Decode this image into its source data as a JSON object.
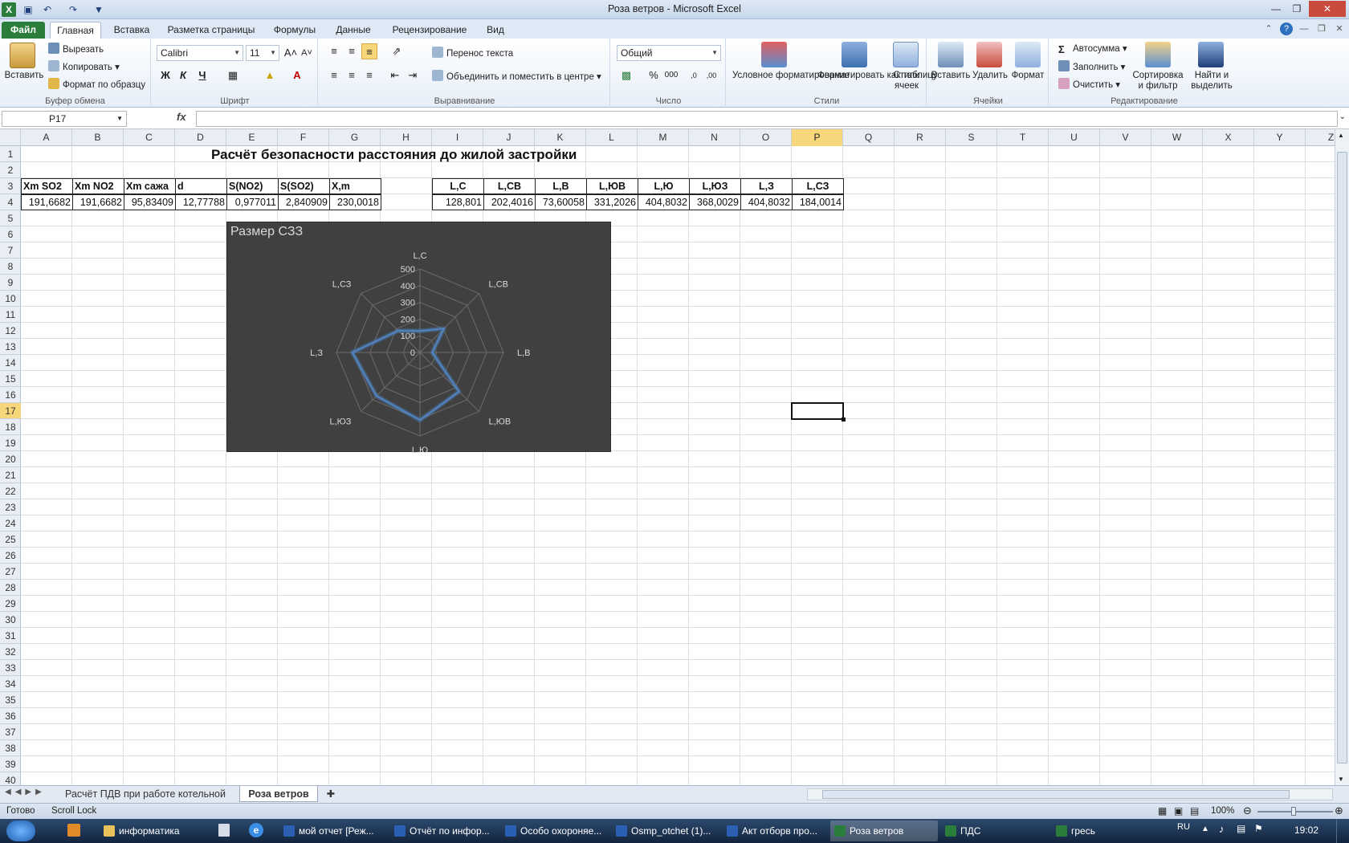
{
  "window": {
    "title": "Роза ветров  -  Microsoft Excel"
  },
  "tabs": [
    "Файл",
    "Главная",
    "Вставка",
    "Разметка страницы",
    "Формулы",
    "Данные",
    "Рецензирование",
    "Вид"
  ],
  "ribbon": {
    "clipboard": {
      "paste": "Вставить",
      "cut": "Вырезать",
      "copy": "Копировать",
      "format_painter": "Формат по образцу",
      "label": "Буфер обмена"
    },
    "font": {
      "name": "Calibri",
      "size": "11",
      "bold": "Ж",
      "italic": "К",
      "underline": "Ч",
      "label": "Шрифт"
    },
    "alignment": {
      "wrap": "Перенос текста",
      "merge": "Объединить и поместить в центре",
      "label": "Выравнивание"
    },
    "number": {
      "format": "Общий",
      "label": "Число"
    },
    "styles": {
      "conditional": "Условное форматирование",
      "as_table": "Форматировать как таблицу",
      "cell_styles": "Стили ячеек",
      "label": "Стили"
    },
    "cells": {
      "insert": "Вставить",
      "delete": "Удалить",
      "format": "Формат",
      "label": "Ячейки"
    },
    "editing": {
      "autosum": "Автосумма",
      "fill": "Заполнить",
      "clear": "Очистить",
      "sort": "Сортировка и фильтр",
      "find": "Найти и выделить",
      "label": "Редактирование"
    }
  },
  "formula_bar": {
    "name_box": "P17",
    "fx": "fx",
    "value": ""
  },
  "columns": [
    "A",
    "B",
    "C",
    "D",
    "E",
    "F",
    "G",
    "H",
    "I",
    "J",
    "K",
    "L",
    "M",
    "N",
    "O",
    "P",
    "Q",
    "R",
    "S",
    "T",
    "U",
    "V",
    "W",
    "X",
    "Y",
    "Z"
  ],
  "rows": [
    "1",
    "2",
    "3",
    "4",
    "5",
    "6",
    "7",
    "8",
    "9",
    "10",
    "11",
    "12",
    "13",
    "14",
    "15",
    "16",
    "17",
    "18",
    "19",
    "20",
    "21",
    "22",
    "23",
    "24",
    "25",
    "26",
    "27",
    "28",
    "29",
    "30",
    "31",
    "32",
    "33",
    "34",
    "35",
    "36",
    "37",
    "38",
    "39",
    "40"
  ],
  "sheet": {
    "title": "Расчёт безопасности расстояния до жилой застройки",
    "table1_headers": [
      "Xm SO2",
      "Xm NO2",
      "Xm сажа",
      "d",
      "S(NO2)",
      "S(SO2)",
      "X,m"
    ],
    "table1_values": [
      "191,6682",
      "191,6682",
      "95,83409",
      "12,77788",
      "0,977011",
      "2,840909",
      "230,0018"
    ],
    "table2_headers": [
      "L,C",
      "L,CB",
      "L,B",
      "L,ЮВ",
      "L,Ю",
      "L,ЮЗ",
      "L,З",
      "L,СЗ"
    ],
    "table2_values": [
      "128,801",
      "202,4016",
      "73,60058",
      "331,2026",
      "404,8032",
      "368,0029",
      "404,8032",
      "184,0014"
    ]
  },
  "chart_data": {
    "type": "radar",
    "title": "Размер СЗЗ",
    "categories": [
      "L,C",
      "L,CB",
      "L,B",
      "L,ЮВ",
      "L,Ю",
      "L,ЮЗ",
      "L,З",
      "L,СЗ"
    ],
    "series": [
      {
        "values": [
          128.801,
          202.4016,
          73.60058,
          331.2026,
          404.8032,
          368.0029,
          404.8032,
          184.0014
        ]
      }
    ],
    "rlim": [
      0,
      500
    ],
    "ticks": [
      "0",
      "100",
      "200",
      "300",
      "400",
      "500"
    ],
    "colors": {
      "background": "#404040",
      "line": "#4f81bd",
      "grid": "#6b6b6b",
      "text": "#d9d9d9"
    }
  },
  "sheet_tabs": [
    "Расчёт ПДВ при работе котельной",
    "Роза ветров"
  ],
  "status": {
    "ready": "Готово",
    "scroll_lock": "Scroll Lock",
    "zoom": "100%"
  },
  "taskbar": {
    "items": [
      "информатика",
      "мой отчет [Реж...",
      "Отчёт по инфор...",
      "Особо охороняе...",
      "Osmp_otchet (1)...",
      "Акт отборв про...",
      "Роза ветров",
      "ПДС",
      "гресь"
    ],
    "lang": "RU",
    "time": "19:02"
  }
}
